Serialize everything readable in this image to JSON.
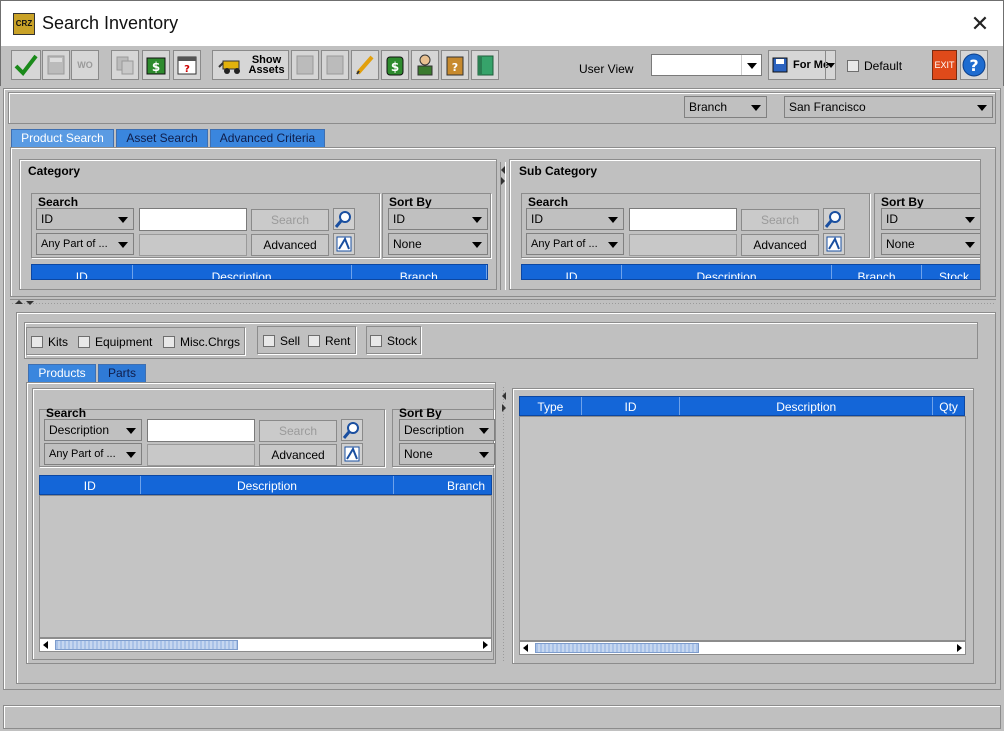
{
  "window": {
    "title": "Search Inventory",
    "app_icon_text": "CRZ"
  },
  "toolbar": {
    "show_assets_label": "Show Assets",
    "disabled_wo_label": "WO",
    "user_view_label": "User View",
    "user_view_value": "",
    "for_me_label": "For Me",
    "default_label": "Default",
    "exit_label": "EXIT",
    "help_label": "?"
  },
  "branch_bar": {
    "type_value": "Branch",
    "location_value": "San Francisco"
  },
  "top_tabs": [
    {
      "label": "Product Search"
    },
    {
      "label": "Asset Search"
    },
    {
      "label": "Advanced Criteria"
    }
  ],
  "category": {
    "title": "Category",
    "search_label": "Search",
    "field_value": "ID",
    "match_value": "Any Part of ...",
    "search_button": "Search",
    "advanced_button": "Advanced",
    "sort_label": "Sort By",
    "sort_value": "ID",
    "sort2_value": "None",
    "columns": [
      "ID",
      "Description",
      "Branch"
    ]
  },
  "subcategory": {
    "title": "Sub Category",
    "search_label": "Search",
    "field_value": "ID",
    "match_value": "Any Part of ...",
    "search_button": "Search",
    "advanced_button": "Advanced",
    "sort_label": "Sort By",
    "sort_value": "ID",
    "sort2_value": "None",
    "columns": [
      "ID",
      "Description",
      "Branch",
      "Stock"
    ]
  },
  "filters": {
    "kits": "Kits",
    "equipment": "Equipment",
    "misc": "Misc.Chrgs",
    "sell": "Sell",
    "rent": "Rent",
    "stock": "Stock"
  },
  "lower_tabs": [
    {
      "label": "Products"
    },
    {
      "label": "Parts"
    }
  ],
  "products": {
    "search_label": "Search",
    "field_value": "Description",
    "match_value": "Any Part of ...",
    "search_button": "Search",
    "advanced_button": "Advanced",
    "sort_label": "Sort By",
    "sort_value": "Description",
    "sort2_value": "None",
    "columns": [
      "ID",
      "Description",
      "Branch"
    ]
  },
  "results": {
    "columns": [
      "Type",
      "ID",
      "Description",
      "Qty"
    ]
  },
  "colors": {
    "header_blue": "#1466d8",
    "tab_blue": "#3a86de",
    "background": "#c0c0c0"
  }
}
